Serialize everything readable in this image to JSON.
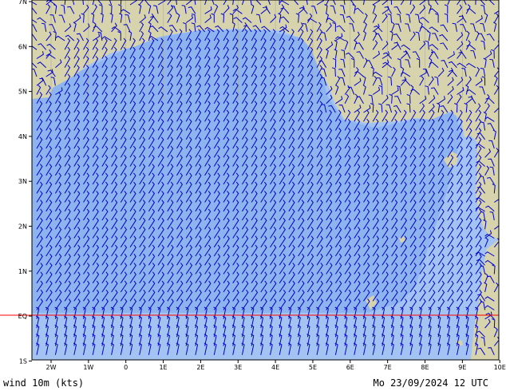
{
  "map": {
    "colors": {
      "ocean": "#a3c4f2",
      "ocean_deep": "#8db4ee",
      "land": "#d6d3ad",
      "barbs": "#0000cc",
      "equator": "#ff0000",
      "frame": "#000000"
    },
    "lat_labels": [
      "7N",
      "6N",
      "5N",
      "4N",
      "3N",
      "2N",
      "1N",
      "EQ",
      "1S"
    ],
    "lon_labels": [
      "2W",
      "1W",
      "0",
      "1E",
      "2E",
      "3E",
      "4E",
      "5E",
      "6E",
      "7E",
      "8E",
      "9E",
      "10E"
    ],
    "field": "wind 10m (kts)",
    "valid_time": "Mo 23/09/2024 12 UTC"
  }
}
